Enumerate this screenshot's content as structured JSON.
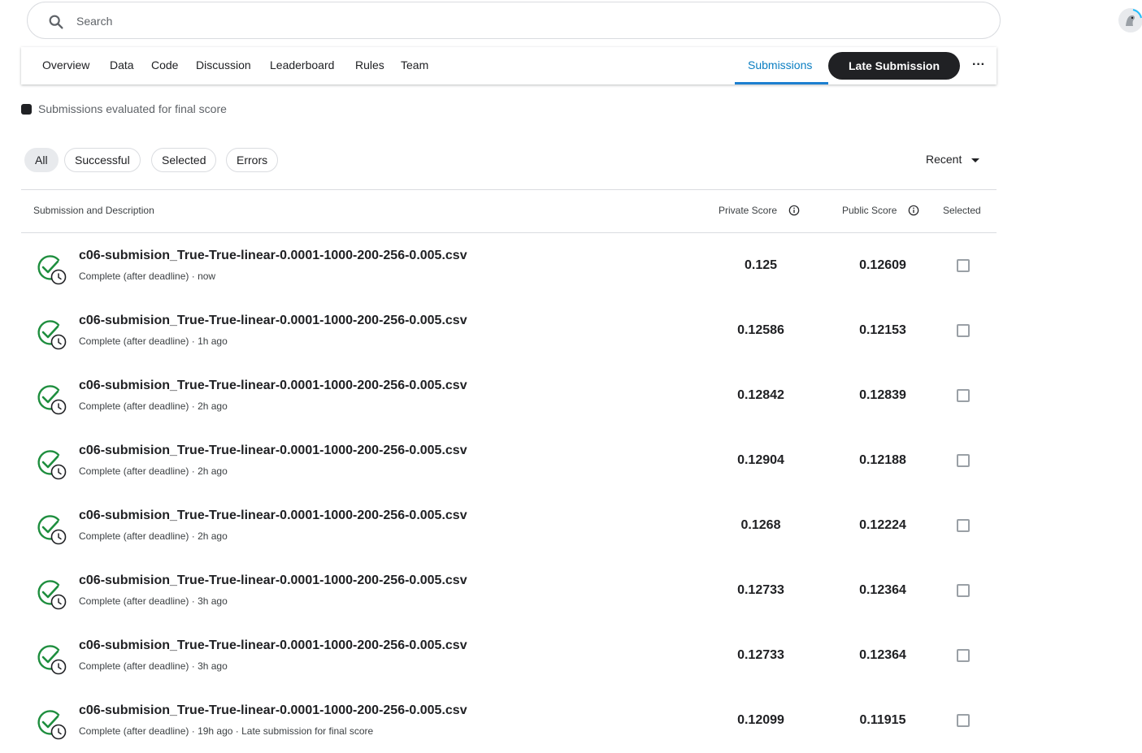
{
  "search": {
    "placeholder": "Search",
    "value": ""
  },
  "nav": {
    "tabs": [
      "Overview",
      "Data",
      "Code",
      "Discussion",
      "Leaderboard",
      "Rules",
      "Team"
    ],
    "active_tab": "Submissions",
    "late_submission_label": "Late Submission",
    "more_label": "···"
  },
  "legend": {
    "text": "Submissions evaluated for final score"
  },
  "filters": {
    "chips": [
      "All",
      "Successful",
      "Selected",
      "Errors"
    ],
    "active": "All",
    "sort_label": "Recent"
  },
  "table": {
    "headers": {
      "submission": "Submission and Description",
      "private": "Private Score",
      "public": "Public Score",
      "selected": "Selected"
    },
    "rows": [
      {
        "name": "c06-submision_True-True-linear-0.0001-1000-200-256-0.005.csv",
        "meta": "Complete (after deadline) · now",
        "private": "0.125",
        "public": "0.12609",
        "selected": false
      },
      {
        "name": "c06-submision_True-True-linear-0.0001-1000-200-256-0.005.csv",
        "meta": "Complete (after deadline) · 1h ago",
        "private": "0.12586",
        "public": "0.12153",
        "selected": false
      },
      {
        "name": "c06-submision_True-True-linear-0.0001-1000-200-256-0.005.csv",
        "meta": "Complete (after deadline) · 2h ago",
        "private": "0.12842",
        "public": "0.12839",
        "selected": false
      },
      {
        "name": "c06-submision_True-True-linear-0.0001-1000-200-256-0.005.csv",
        "meta": "Complete (after deadline) · 2h ago",
        "private": "0.12904",
        "public": "0.12188",
        "selected": false
      },
      {
        "name": "c06-submision_True-True-linear-0.0001-1000-200-256-0.005.csv",
        "meta": "Complete (after deadline) · 2h ago",
        "private": "0.1268",
        "public": "0.12224",
        "selected": false
      },
      {
        "name": "c06-submision_True-True-linear-0.0001-1000-200-256-0.005.csv",
        "meta": "Complete (after deadline) · 3h ago",
        "private": "0.12733",
        "public": "0.12364",
        "selected": false
      },
      {
        "name": "c06-submision_True-True-linear-0.0001-1000-200-256-0.005.csv",
        "meta": "Complete (after deadline) · 3h ago",
        "private": "0.12733",
        "public": "0.12364",
        "selected": false
      },
      {
        "name": "c06-submision_True-True-linear-0.0001-1000-200-256-0.005.csv",
        "meta": "Complete (after deadline) · 19h ago · Late submission for final score",
        "private": "0.12099",
        "public": "0.11915",
        "selected": false
      }
    ]
  },
  "colors": {
    "success": "#1e8e3e",
    "accent": "#0a7ec2",
    "dark": "#202124"
  },
  "icons": {
    "search": "search-icon",
    "status": "success-check-clock-icon",
    "info": "info-icon",
    "avatar": "avatar"
  }
}
